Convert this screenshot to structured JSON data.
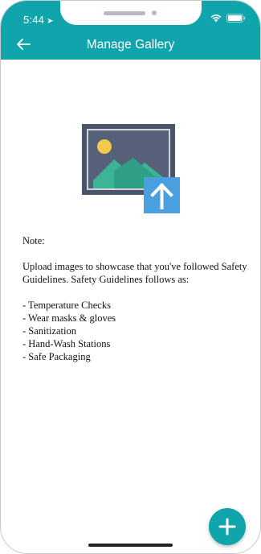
{
  "status_bar": {
    "time": "5:44",
    "location_icon": "location-arrow-icon",
    "wifi_icon": "wifi-icon",
    "battery_icon": "battery-icon"
  },
  "header": {
    "title": "Manage Gallery",
    "back_icon": "back-arrow-icon",
    "background": "#10a5ad"
  },
  "upload_illustration": {
    "icon": "image-upload-icon"
  },
  "note": {
    "heading": "Note:",
    "intro": "Upload images to showcase that you've followed Safety Guidelines. Safety Guidelines follows as:",
    "items": [
      "- Temperature Checks",
      "- Wear masks & gloves",
      "- Sanitization",
      "- Hand-Wash Stations",
      "- Safe Packaging"
    ]
  },
  "fab": {
    "icon": "plus-icon",
    "color": "#10a5ad"
  }
}
